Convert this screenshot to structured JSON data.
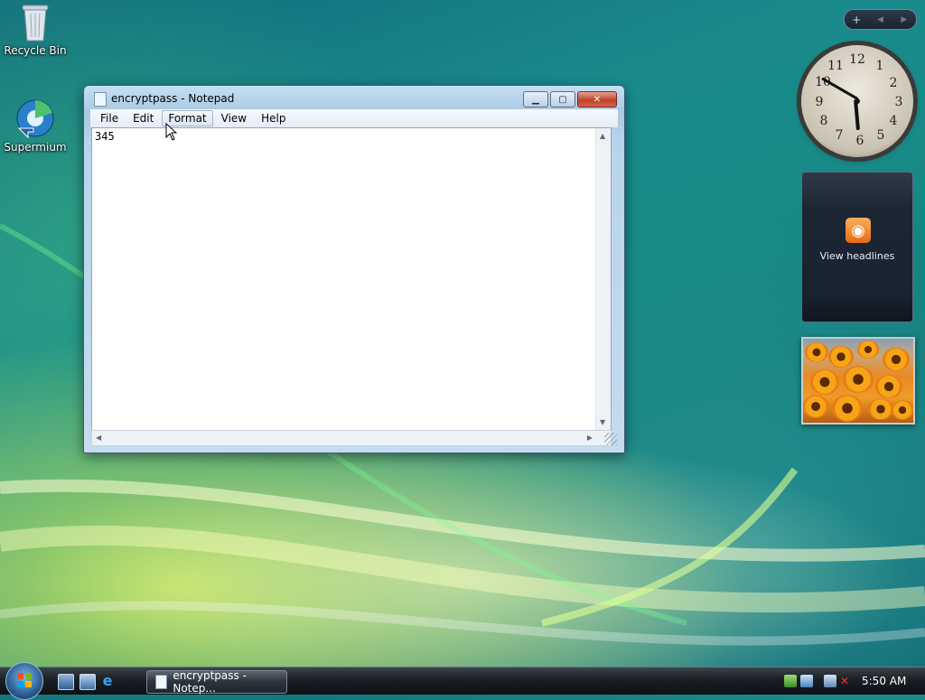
{
  "desktop": {
    "icons": [
      {
        "label": "Recycle Bin",
        "icon": "recycle-bin-icon"
      },
      {
        "label": "Supermium",
        "icon": "supermium-browser-icon"
      }
    ]
  },
  "notepad": {
    "title": "encryptpass - Notepad",
    "menu": [
      "File",
      "Edit",
      "Format",
      "View",
      "Help"
    ],
    "hovered_menu": "Format",
    "content": "345"
  },
  "gadgets": {
    "clock": {
      "numbers": [
        "12",
        "1",
        "2",
        "3",
        "4",
        "5",
        "6",
        "7",
        "8",
        "9",
        "10",
        "11"
      ],
      "hour": 5,
      "minute": 50
    },
    "feed": {
      "label": "View headlines",
      "icon": "rss-icon"
    },
    "slideshow": {
      "subject": "orange flowers photo"
    }
  },
  "taskbar": {
    "start_icon": "windows-start-icon",
    "quicklaunch": [
      "show-desktop-icon",
      "switch-windows-icon",
      "internet-explorer-icon"
    ],
    "task_label": "encryptpass - Notep...",
    "tray_icons": [
      "safely-remove-icon",
      "network-icon",
      "network-connections-icon",
      "volume-muted-icon"
    ],
    "clock": "5:50 AM"
  }
}
